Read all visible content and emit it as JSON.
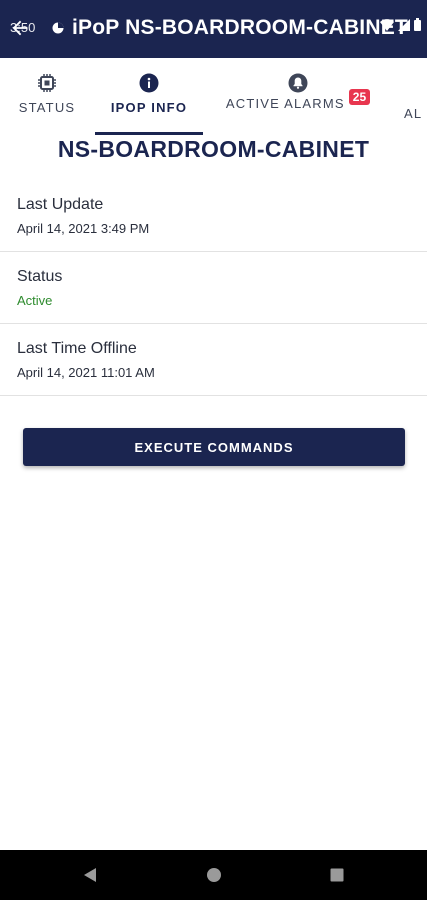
{
  "status_bar": {
    "time": "3:50"
  },
  "app_bar": {
    "title": "iPoP NS-BOARDROOM-CABINET",
    "back_icon": "arrow-left-icon",
    "background": "#1b2550"
  },
  "tabs": [
    {
      "label": "STATUS",
      "icon": "chip-icon",
      "active": false
    },
    {
      "label": "IPOP INFO",
      "icon": "info-icon",
      "active": true
    },
    {
      "label": "ACTIVE ALARMS",
      "icon": "bell-icon",
      "active": false,
      "badge": "25"
    },
    {
      "label": "AL",
      "icon": "",
      "active": false
    }
  ],
  "page_title": "NS-BOARDROOM-CABINET",
  "info": [
    {
      "key": "Last Update",
      "value": "April 14, 2021 3:49 PM"
    },
    {
      "key": "Status",
      "value": "Active",
      "value_color": "#2e8b2e"
    },
    {
      "key": "Last Time Offline",
      "value": "April 14, 2021 11:01 AM"
    }
  ],
  "execute_button": {
    "label": "EXECUTE COMMANDS"
  },
  "colors": {
    "primary": "#1b2550",
    "badge": "#e8364f",
    "active_green": "#2e8b2e"
  }
}
